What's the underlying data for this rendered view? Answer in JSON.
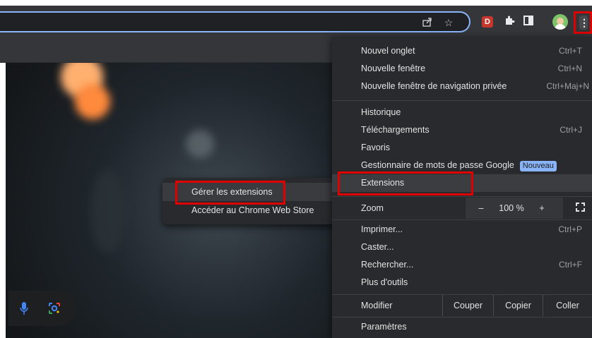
{
  "menu": {
    "items_group1": [
      {
        "label": "Nouvel onglet",
        "shortcut": "Ctrl+T"
      },
      {
        "label": "Nouvelle fenêtre",
        "shortcut": "Ctrl+N"
      },
      {
        "label": "Nouvelle fenêtre de navigation privée",
        "shortcut": "Ctrl+Maj+N"
      }
    ],
    "items_group2": [
      {
        "label": "Historique",
        "shortcut": ""
      },
      {
        "label": "Téléchargements",
        "shortcut": "Ctrl+J"
      },
      {
        "label": "Favoris",
        "shortcut": ""
      },
      {
        "label": "Gestionnaire de mots de passe Google",
        "badge": "Nouveau"
      },
      {
        "label": "Extensions",
        "shortcut": ""
      }
    ],
    "zoom": {
      "label": "Zoom",
      "minus": "–",
      "value": "100 %",
      "plus": "+"
    },
    "items_group3": [
      {
        "label": "Imprimer...",
        "shortcut": "Ctrl+P"
      },
      {
        "label": "Caster...",
        "shortcut": ""
      },
      {
        "label": "Rechercher...",
        "shortcut": "Ctrl+F"
      },
      {
        "label": "Plus d'outils",
        "shortcut": ""
      }
    ],
    "edit": {
      "label": "Modifier",
      "cut": "Couper",
      "copy": "Copier",
      "paste": "Coller"
    },
    "settings": {
      "label": "Paramètres"
    }
  },
  "submenu": {
    "items": [
      {
        "label": "Gérer les extensions"
      },
      {
        "label": "Accéder au Chrome Web Store"
      }
    ]
  },
  "toolbar": {
    "icons": [
      "share-icon",
      "bookmark-star-icon",
      "extension-red-icon",
      "puzzle-icon",
      "side-panel-icon",
      "profile-avatar",
      "more-menu-icon"
    ],
    "ext_letter": "D"
  },
  "colors": {
    "highlight_box": "#e00000",
    "menu_bg": "#292a2d",
    "badge": "#8ab4f8",
    "omnibox_border": "#8ab4f8"
  }
}
